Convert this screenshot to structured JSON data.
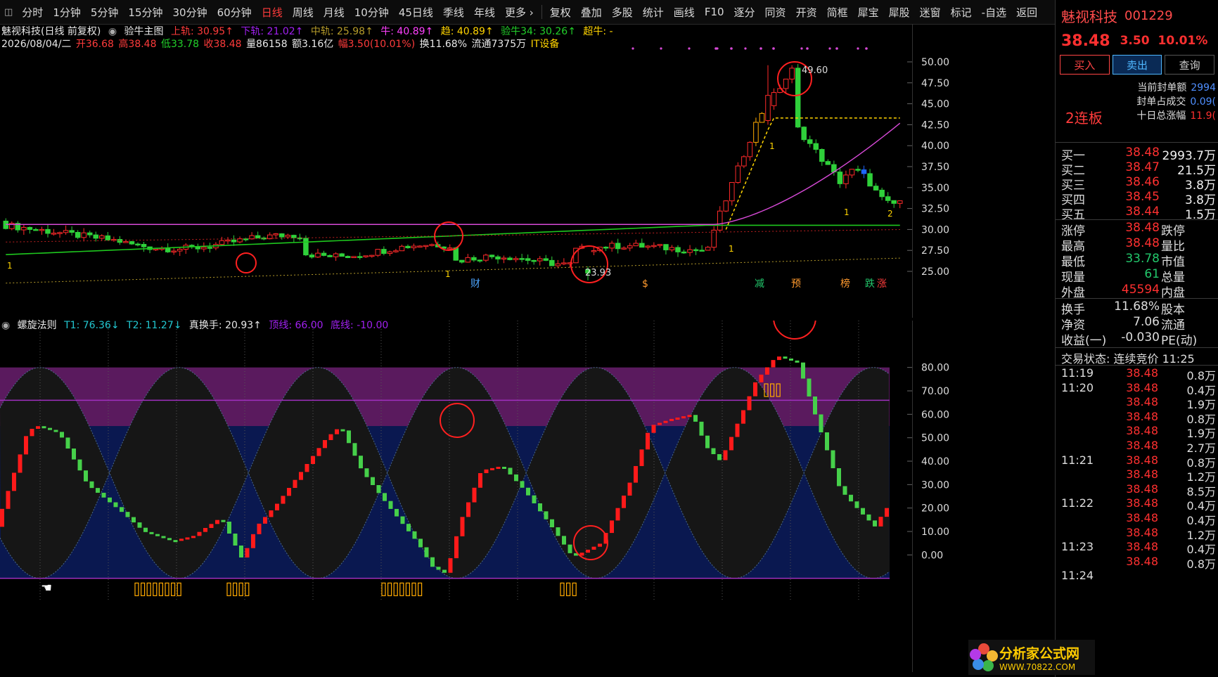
{
  "toolbar": {
    "items": [
      "分时",
      "1分钟",
      "5分钟",
      "15分钟",
      "30分钟",
      "60分钟",
      "日线",
      "周线",
      "月线",
      "10分钟",
      "45日线",
      "季线",
      "年线",
      "更多 ›",
      "复权",
      "叠加",
      "多股",
      "统计",
      "画线",
      "F10",
      "逐分",
      "同资",
      "开资",
      "简框",
      "犀宝",
      "犀股",
      "迷窗",
      "标记",
      "-自选",
      "返回"
    ],
    "active": "日线"
  },
  "main": {
    "legend": {
      "stock": "魅视科技(日线 前复权)",
      "indicator": "验牛主图",
      "upper": "上轨: 30.95↑",
      "lower": "下轨: 21.02↑",
      "mid": "中轨: 25.98↑",
      "niu": "牛: 40.89↑",
      "qu": "趋: 40.89↑",
      "yanniu": "验牛34: 30.26↑",
      "chaoniu": "超牛: -"
    },
    "info": {
      "date": "2026/08/04/二",
      "open": "开36.68",
      "high": "高38.48",
      "low": "低33.78",
      "close": "收38.48",
      "volume": "量86158",
      "amount": "额3.16亿",
      "change": "幅3.50(10.01%)",
      "turnover": "换11.68%",
      "float": "流通7375万",
      "sector": "IT设备"
    },
    "yaxis": [
      "50.00",
      "47.50",
      "45.00",
      "42.50",
      "40.00",
      "37.50",
      "35.00",
      "32.50",
      "30.00",
      "27.50",
      "25.00"
    ],
    "annotations": {
      "high_label": "49.60",
      "low_label": "23.93",
      "markers": [
        {
          "text": "财",
          "color": "#4da6ff"
        },
        {
          "text": "$",
          "color": "#ff9a2e"
        },
        {
          "text": "减",
          "color": "#22c76b"
        },
        {
          "text": "预",
          "color": "#ff9a2e"
        },
        {
          "text": "榜",
          "color": "#ff9a2e"
        },
        {
          "text": "跌",
          "color": "#22c76b"
        },
        {
          "text": "涨",
          "color": "#ff3b3b"
        }
      ],
      "labels": {
        "one": "1",
        "two": "2"
      }
    }
  },
  "sub": {
    "legend": {
      "name": "螺旋法则",
      "t1": "T1: 76.36↓",
      "t2": "T2: 11.27↓",
      "zhs": "真换手: 20.93↑",
      "top": "顶线: 66.00",
      "bottom": "底线: -10.00"
    },
    "yaxis": [
      "80.00",
      "70.00",
      "60.00",
      "50.00",
      "40.00",
      "30.00",
      "20.00",
      "10.00",
      "0.00"
    ]
  },
  "chart_data": [
    {
      "type": "line",
      "title": "验牛主图",
      "series": [
        {
          "name": "上轨",
          "values": [
            30.95
          ]
        },
        {
          "name": "下轨",
          "values": [
            21.02
          ]
        },
        {
          "name": "中轨",
          "values": [
            25.98
          ]
        }
      ],
      "ylim": [
        23.5,
        51.0
      ],
      "extremes": {
        "high": 49.6,
        "low": 23.93
      }
    },
    {
      "type": "line",
      "title": "螺旋法则",
      "series": [
        {
          "name": "T1",
          "values": [
            76.36
          ]
        },
        {
          "name": "T2",
          "values": [
            11.27
          ]
        }
      ],
      "top_line": 66.0,
      "bottom_line": -10.0,
      "ylim": [
        -20,
        88
      ]
    }
  ],
  "panel": {
    "name": "魅视科技",
    "code": "001229",
    "price": "38.48",
    "change": "3.50",
    "pct": "10.01%",
    "buttons": {
      "buy": "买入",
      "sell": "卖出",
      "query": "查询"
    },
    "lianban": "2连板",
    "seal": [
      {
        "k": "当前封单额",
        "v": "2994"
      },
      {
        "k": "封单占成交",
        "v": "0.09("
      },
      {
        "k": "十日总涨幅",
        "v": "11.9("
      }
    ],
    "bids": [
      {
        "lbl": "买一",
        "pr": "38.48",
        "vol": "2993.7万"
      },
      {
        "lbl": "买二",
        "pr": "38.47",
        "vol": "21.5万"
      },
      {
        "lbl": "买三",
        "pr": "38.46",
        "vol": "3.8万"
      },
      {
        "lbl": "买四",
        "pr": "38.45",
        "vol": "3.8万"
      },
      {
        "lbl": "买五",
        "pr": "38.44",
        "vol": "1.5万"
      }
    ],
    "stats": [
      {
        "k": "涨停",
        "v": "38.48",
        "k2": "跌停",
        "color": "#ff3030"
      },
      {
        "k": "最高",
        "v": "38.48",
        "k2": "量比",
        "color": "#ff3030"
      },
      {
        "k": "最低",
        "v": "33.78",
        "k2": "市值",
        "color": "#22c76b"
      },
      {
        "k": "现量",
        "v": "61",
        "k2": "总量",
        "color": "#22c76b"
      },
      {
        "k": "外盘",
        "v": "45594",
        "k2": "内盘",
        "color": "#ff3030"
      }
    ],
    "stats2": [
      {
        "k": "换手",
        "v": "11.68%",
        "k2": "股本",
        "color": "#ddd"
      },
      {
        "k": "净资",
        "v": "7.06",
        "k2": "流通",
        "color": "#ddd"
      },
      {
        "k": "收益(一)",
        "v": "-0.030",
        "k2": "PE(动)",
        "color": "#ddd"
      }
    ],
    "trade_state": "交易状态: 连续竞价 11:25",
    "trades": [
      {
        "t": "11:19",
        "p": "38.48",
        "v": "0.8万"
      },
      {
        "t": "11:20",
        "p": "38.48",
        "v": "0.4万"
      },
      {
        "t": "",
        "p": "38.48",
        "v": "1.9万"
      },
      {
        "t": "",
        "p": "38.48",
        "v": "0.8万"
      },
      {
        "t": "",
        "p": "38.48",
        "v": "1.9万"
      },
      {
        "t": "",
        "p": "38.48",
        "v": "2.7万"
      },
      {
        "t": "11:21",
        "p": "38.48",
        "v": "0.8万"
      },
      {
        "t": "",
        "p": "38.48",
        "v": "1.2万"
      },
      {
        "t": "",
        "p": "38.48",
        "v": "8.5万"
      },
      {
        "t": "11:22",
        "p": "38.48",
        "v": "0.4万"
      },
      {
        "t": "",
        "p": "38.48",
        "v": "0.4万"
      },
      {
        "t": "",
        "p": "38.48",
        "v": "1.2万"
      },
      {
        "t": "11:23",
        "p": "38.48",
        "v": "0.4万"
      },
      {
        "t": "",
        "p": "38.48",
        "v": "0.8万"
      },
      {
        "t": "11:24",
        "p": "",
        "v": ""
      }
    ],
    "logo": {
      "line1": "分析家公式网",
      "line2": "WWW.70822.COM"
    }
  },
  "colors": {
    "up": "#ff2222",
    "down": "#46d04a",
    "magenta": "#d84ad8",
    "green": "#1ec81e",
    "gold": "#ffaa00"
  }
}
